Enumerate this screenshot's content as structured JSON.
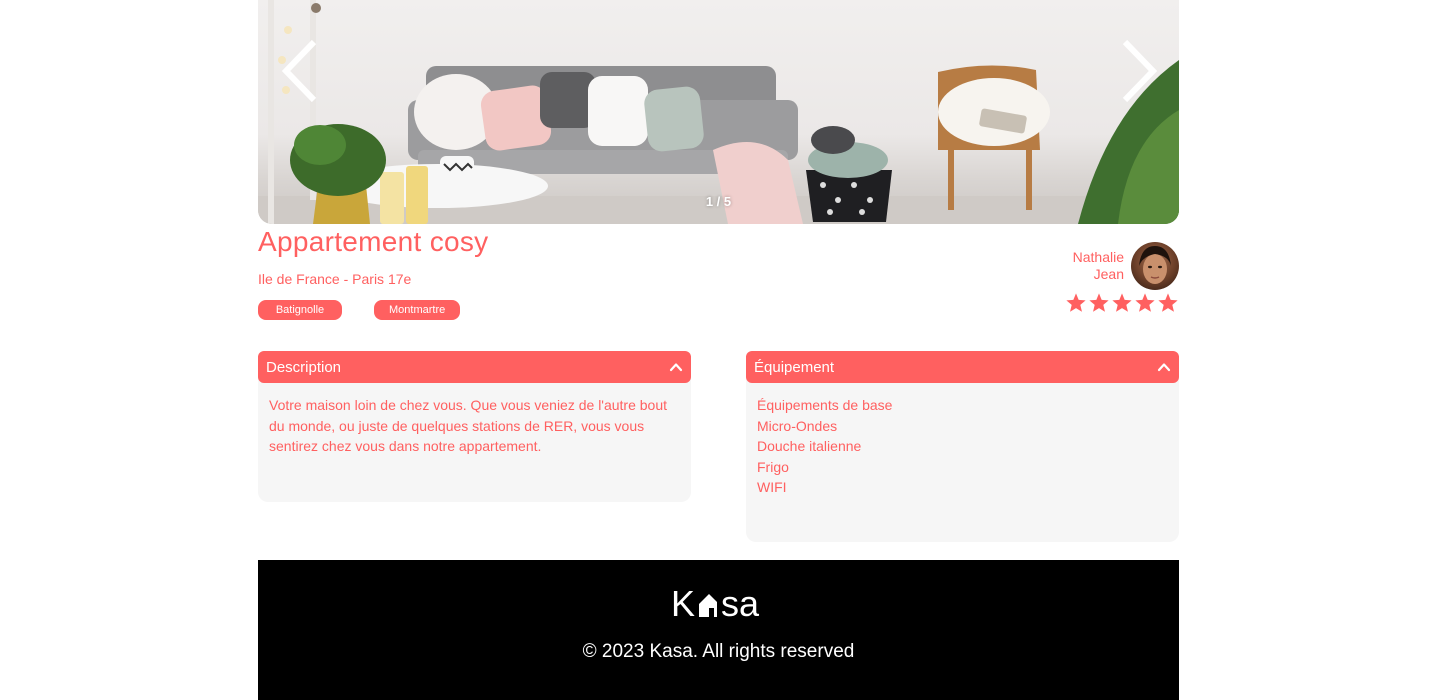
{
  "carousel": {
    "counter": "1 / 5",
    "prev_icon": "chevron-left-icon",
    "next_icon": "chevron-right-icon",
    "current_index": 1,
    "total": 5
  },
  "listing": {
    "title": "Appartement cosy",
    "location": "Ile de France - Paris 17e",
    "tags": [
      "Batignolle",
      "Montmartre"
    ]
  },
  "host": {
    "first_name": "Nathalie",
    "last_name": "Jean",
    "avatar_icon": "host-avatar"
  },
  "rating": {
    "value": 5,
    "max": 5,
    "active_color": "#ff6060"
  },
  "description": {
    "title": "Description",
    "text": "Votre maison loin de chez vous. Que vous veniez de l'autre bout du monde, ou juste de quelques stations de RER, vous vous sentirez chez vous dans notre appartement.",
    "icon": "chevron-up-icon"
  },
  "equipment": {
    "title": "Équipement",
    "items": [
      "Équipements de base",
      "Micro-Ondes",
      "Douche italienne",
      "Frigo",
      "WIFI"
    ],
    "icon": "chevron-up-icon"
  },
  "footer": {
    "logo_text_1": "K",
    "logo_text_2": "sa",
    "copyright": "© 2023 Kasa. All rights reserved"
  },
  "colors": {
    "primary": "#ff6060",
    "background_light": "#f6f6f6",
    "footer_bg": "#000000"
  }
}
